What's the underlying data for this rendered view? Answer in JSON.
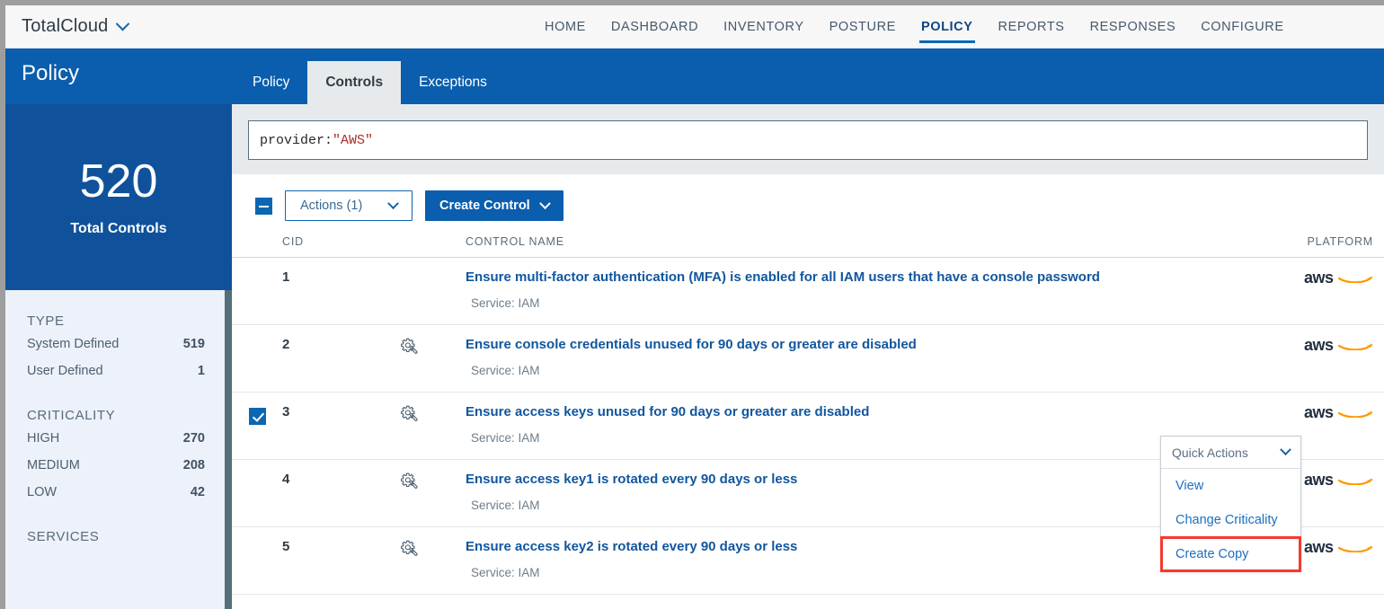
{
  "topbar": {
    "brand": "TotalCloud",
    "brand_caret_icon": "chevron-down-icon",
    "nav": [
      {
        "label": "HOME",
        "active": false
      },
      {
        "label": "DASHBOARD",
        "active": false
      },
      {
        "label": "INVENTORY",
        "active": false
      },
      {
        "label": "POSTURE",
        "active": false
      },
      {
        "label": "POLICY",
        "active": true
      },
      {
        "label": "REPORTS",
        "active": false
      },
      {
        "label": "RESPONSES",
        "active": false
      },
      {
        "label": "CONFIGURE",
        "active": false
      }
    ]
  },
  "subheader": {
    "title": "Policy",
    "tabs": [
      {
        "label": "Policy",
        "active": false
      },
      {
        "label": "Controls",
        "active": true
      },
      {
        "label": "Exceptions",
        "active": false
      }
    ]
  },
  "sidebar": {
    "kpi": {
      "value": "520",
      "label": "Total Controls"
    },
    "facets": [
      {
        "title": "TYPE",
        "rows": [
          {
            "label": "System Defined",
            "count": "519"
          },
          {
            "label": "User Defined",
            "count": "1"
          }
        ]
      },
      {
        "title": "CRITICALITY",
        "rows": [
          {
            "label": "HIGH",
            "count": "270"
          },
          {
            "label": "MEDIUM",
            "count": "208"
          },
          {
            "label": "LOW",
            "count": "42"
          }
        ]
      },
      {
        "title": "SERVICES",
        "rows": []
      }
    ]
  },
  "search": {
    "query_key": "provider:",
    "query_value": "\"AWS\""
  },
  "toolbar": {
    "select_all_state": "indeterminate",
    "actions_label": "Actions (1)",
    "actions_caret_icon": "chevron-down-icon",
    "create_control_label": "Create Control",
    "create_control_caret_icon": "chevron-down-icon"
  },
  "table": {
    "columns": {
      "cid": "CID",
      "control_name": "CONTROL NAME",
      "platform": "PLATFORM"
    },
    "rows": [
      {
        "cid": "1",
        "has_gear": false,
        "name": "Ensure multi-factor authentication (MFA) is enabled for all IAM users that have a console password",
        "service": "Service: IAM",
        "platform": "aws",
        "checked": false
      },
      {
        "cid": "2",
        "has_gear": true,
        "name": "Ensure console credentials unused for 90 days or greater are disabled",
        "service": "Service: IAM",
        "platform": "aws",
        "checked": false
      },
      {
        "cid": "3",
        "has_gear": true,
        "name": "Ensure access keys unused for 90 days or greater are disabled",
        "service": "Service: IAM",
        "platform": "aws",
        "checked": true
      },
      {
        "cid": "4",
        "has_gear": true,
        "name": "Ensure access key1 is rotated every 90 days or less",
        "service": "Service: IAM",
        "platform": "aws",
        "checked": false
      },
      {
        "cid": "5",
        "has_gear": true,
        "name": "Ensure access key2 is rotated every 90 days or less",
        "service": "Service: IAM",
        "platform": "aws",
        "checked": false
      }
    ]
  },
  "quick_actions": {
    "header": "Quick Actions",
    "caret_icon": "chevron-down-icon",
    "items": [
      {
        "label": "View",
        "highlighted": false
      },
      {
        "label": "Change Criticality",
        "highlighted": false
      },
      {
        "label": "Create Copy",
        "highlighted": true
      }
    ]
  },
  "colors": {
    "brand_blue": "#0b5ead",
    "kpi_blue": "#0f529b",
    "link_blue": "#11569e",
    "highlight_red": "#f23b2f",
    "aws_orange": "#ff9900",
    "sidebar_bg": "#edf1f9"
  }
}
